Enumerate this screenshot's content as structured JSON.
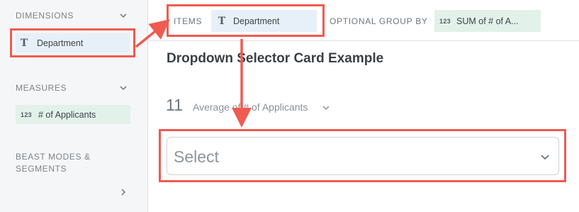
{
  "sidebar": {
    "dimensions": {
      "heading": "DIMENSIONS",
      "field": {
        "type_icon": "T",
        "label": "Department"
      }
    },
    "measures": {
      "heading": "MEASURES",
      "field": {
        "type_icon": "123",
        "label": "# of Applicants"
      }
    },
    "beast_modes": {
      "heading_line1": "BEAST MODES &",
      "heading_line2": "SEGMENTS"
    }
  },
  "topbar": {
    "items_label": "ITEMS",
    "items_pill": {
      "type_icon": "T",
      "label": "Department"
    },
    "group_label": "OPTIONAL GROUP BY",
    "group_pill": {
      "type_icon": "123",
      "label": "SUM of # of A..."
    }
  },
  "card": {
    "title": "Dropdown Selector Card Example",
    "summary_number": "11",
    "summary_label": "Average of # of Applicants",
    "select_placeholder": "Select"
  },
  "colors": {
    "annotation": "#ef5b50",
    "dimension_pill": "#e7eff8",
    "measure_pill": "#e2f1ea"
  }
}
